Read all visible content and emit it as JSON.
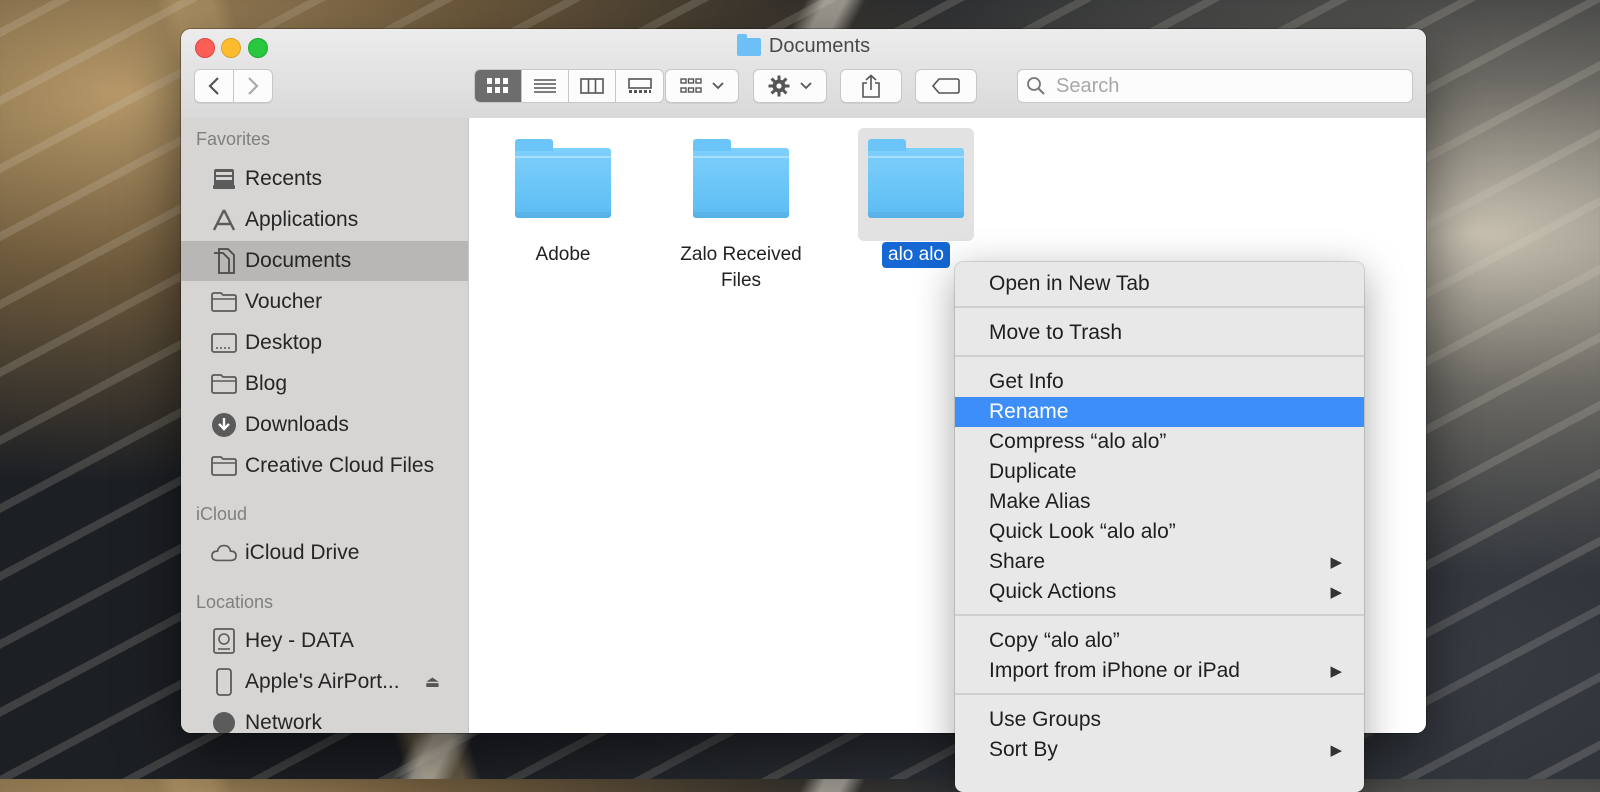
{
  "window": {
    "title": "Documents"
  },
  "toolbar": {
    "search_placeholder": "Search",
    "view_modes": [
      "icon",
      "list",
      "column",
      "gallery"
    ],
    "accent_color": "#6d6d6d"
  },
  "sidebar": {
    "favorites_header": "Favorites",
    "favorites": [
      {
        "label": "Recents",
        "icon": "recents-icon"
      },
      {
        "label": "Applications",
        "icon": "applications-icon"
      },
      {
        "label": "Documents",
        "icon": "documents-icon",
        "selected": true
      },
      {
        "label": "Voucher",
        "icon": "folder-icon"
      },
      {
        "label": "Desktop",
        "icon": "desktop-icon"
      },
      {
        "label": "Blog",
        "icon": "folder-icon"
      },
      {
        "label": "Downloads",
        "icon": "downloads-icon"
      },
      {
        "label": "Creative Cloud Files",
        "icon": "folder-icon"
      }
    ],
    "icloud_header": "iCloud",
    "icloud": [
      {
        "label": "iCloud Drive",
        "icon": "cloud-icon"
      }
    ],
    "locations_header": "Locations",
    "locations": [
      {
        "label": "Hey - DATA",
        "icon": "disk-icon"
      },
      {
        "label": "Apple's AirPort...",
        "icon": "device-icon"
      },
      {
        "label": "Network",
        "icon": "network-icon"
      }
    ]
  },
  "files": [
    {
      "label": "Adobe"
    },
    {
      "label": "Zalo Received Files"
    },
    {
      "label": "alo alo",
      "selected": true
    }
  ],
  "context_menu": {
    "highlight_color": "#3d8ef8",
    "items": [
      {
        "label": "Open in New Tab"
      },
      {
        "label": "Move to Trash"
      },
      {
        "label": "Get Info"
      },
      {
        "label": "Rename",
        "highlighted": true
      },
      {
        "label": "Compress “alo alo”"
      },
      {
        "label": "Duplicate"
      },
      {
        "label": "Make Alias"
      },
      {
        "label": "Quick Look “alo alo”"
      },
      {
        "label": "Share",
        "submenu": true
      },
      {
        "label": "Quick Actions",
        "submenu": true
      },
      {
        "label": "Copy “alo alo”"
      },
      {
        "label": "Import from iPhone or iPad",
        "submenu": true
      },
      {
        "label": "Use Groups"
      },
      {
        "label": "Sort By",
        "submenu": true
      }
    ]
  }
}
